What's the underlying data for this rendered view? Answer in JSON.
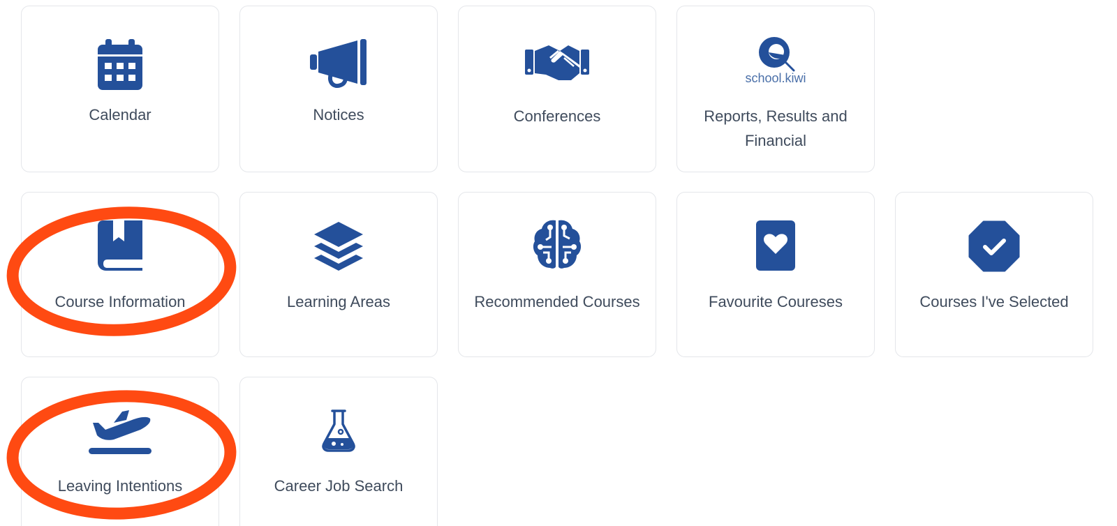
{
  "accent_color": "#24509a",
  "annotation_color": "#ff4a12",
  "tiles": [
    {
      "label": "Calendar",
      "icon": "calendar-icon"
    },
    {
      "label": "Notices",
      "icon": "megaphone-icon"
    },
    {
      "label": "Conferences",
      "icon": "handshake-icon"
    },
    {
      "label": "Reports, Results and Financial",
      "icon": "school-kiwi-logo",
      "logo_text": "school.kiwi"
    },
    {
      "label": "Course Information",
      "icon": "book-icon"
    },
    {
      "label": "Learning Areas",
      "icon": "layers-icon"
    },
    {
      "label": "Recommended Courses",
      "icon": "brain-circuit-icon"
    },
    {
      "label": "Favourite Coureses",
      "icon": "heart-card-icon"
    },
    {
      "label": "Courses I've Selected",
      "icon": "check-badge-icon"
    },
    {
      "label": "Leaving Intentions",
      "icon": "plane-departure-icon"
    },
    {
      "label": "Career Job Search",
      "icon": "flask-icon"
    }
  ]
}
